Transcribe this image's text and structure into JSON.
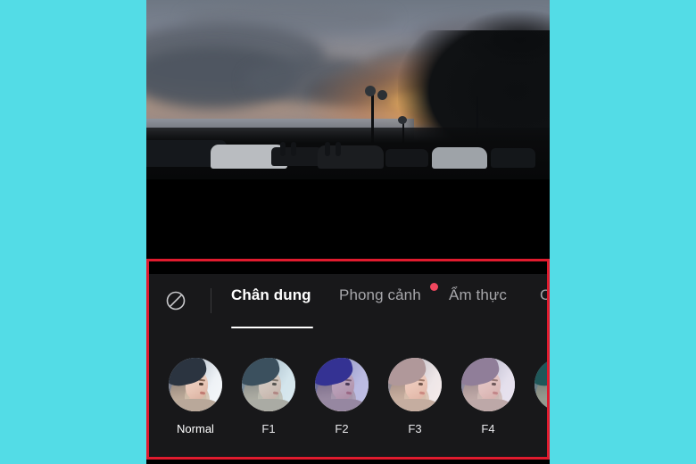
{
  "theme": {
    "page_background": "#53dce6",
    "panel_background": "#18181a",
    "highlight_border": "#e01b2e",
    "accent_badge": "#f0475e",
    "active_text": "#ffffff",
    "idle_text": "#a6a6aa"
  },
  "preview": {
    "name": "photo-preview",
    "description": "sunset beach road with cars and motorbikes"
  },
  "filter_panel": {
    "no_filter_icon": "no-filter-icon",
    "tabs": [
      {
        "label": "Chân dung",
        "active": true,
        "badge": false
      },
      {
        "label": "Phong cảnh",
        "active": false,
        "badge": true
      },
      {
        "label": "Ẩm thực",
        "active": false,
        "badge": false
      },
      {
        "label": "C",
        "active": false,
        "badge": false
      }
    ],
    "filters": [
      {
        "label": "Normal",
        "selected": true,
        "tint": "none"
      },
      {
        "label": "F1",
        "selected": false,
        "tint": "rgba(120,180,200,0.22)"
      },
      {
        "label": "F2",
        "selected": false,
        "tint": "rgba(70,60,180,0.30)"
      },
      {
        "label": "F3",
        "selected": false,
        "tint": "rgba(240,190,180,0.22)"
      },
      {
        "label": "F4",
        "selected": false,
        "tint": "rgba(200,170,210,0.26)"
      },
      {
        "label": "",
        "selected": false,
        "tint": "rgba(60,120,120,0.30)"
      }
    ]
  }
}
